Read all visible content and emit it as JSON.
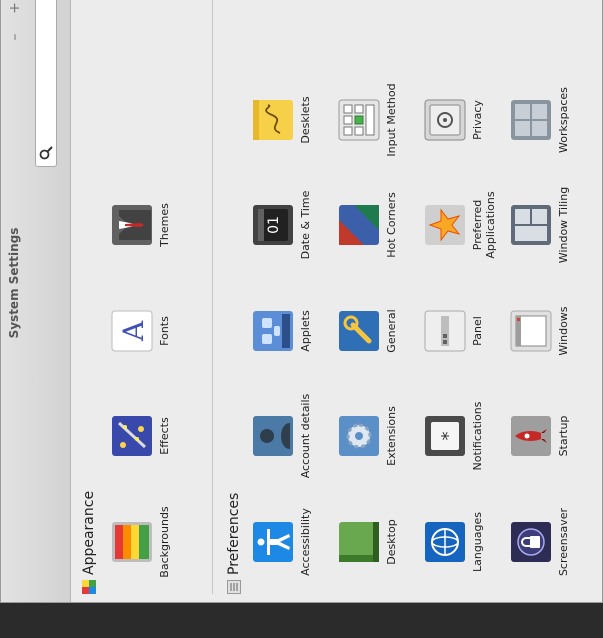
{
  "window": {
    "title": "System Settings"
  },
  "search": {
    "placeholder": "",
    "value": ""
  },
  "controls": {
    "close": "×",
    "maximize": "+",
    "minimize": "–"
  },
  "sections": {
    "appearance": {
      "title": "Appearance",
      "items": [
        "Backgrounds",
        "Effects",
        "Fonts",
        "Themes"
      ]
    },
    "preferences": {
      "title": "Preferences",
      "items": [
        "Accessibility",
        "Account details",
        "Applets",
        "Date & Time",
        "Desklets",
        "Desktop",
        "Extensions",
        "General",
        "Hot Corners",
        "Input Method",
        "Languages",
        "Notifications",
        "Panel",
        "Preferred Applications",
        "Privacy",
        "Screensaver",
        "Startup",
        "Windows",
        "Window Tiling",
        "Workspaces"
      ]
    }
  },
  "icons": {
    "search": "search-icon",
    "clear": "clear-search-icon",
    "appearance": "appearance-category-icon",
    "preferences": "preferences-category-icon"
  },
  "colors": {
    "window_bg": "#ececec",
    "titlebar": "#d8d8d8",
    "text": "#222222"
  }
}
